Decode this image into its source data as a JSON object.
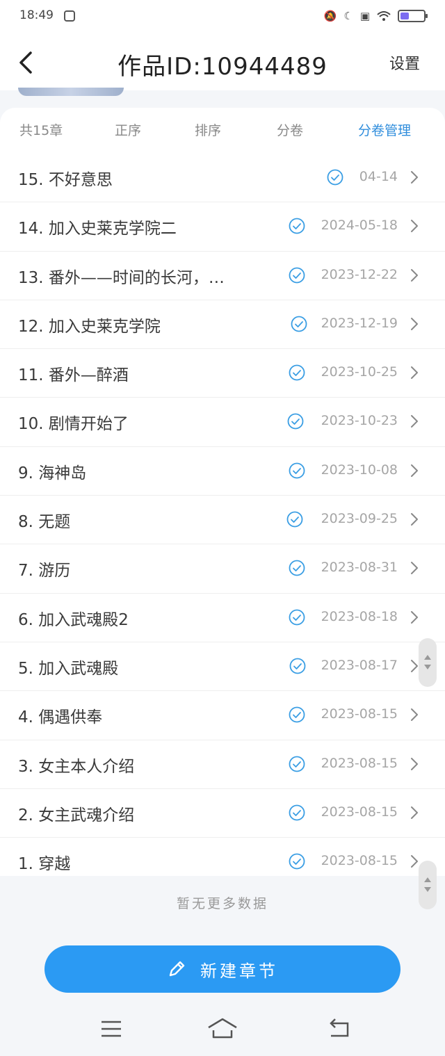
{
  "status_bar": {
    "time": "18:49"
  },
  "header": {
    "title": "作品ID:10944489",
    "settings_label": "设置"
  },
  "tabs": {
    "count": "共15章",
    "order": "正序",
    "sort": "排序",
    "volume": "分卷",
    "volume_manage": "分卷管理"
  },
  "chapters": [
    {
      "title": "15. 不好意思",
      "date": "04-14"
    },
    {
      "title": "14. 加入史莱克学院二",
      "date": "2024-05-18"
    },
    {
      "title": "13. 番外——时间的长河，…",
      "date": "2023-12-22"
    },
    {
      "title": "12. 加入史莱克学院",
      "date": "2023-12-19"
    },
    {
      "title": "11. 番外—醉酒",
      "date": "2023-10-25"
    },
    {
      "title": "10. 剧情开始了",
      "date": "2023-10-23"
    },
    {
      "title": "9. 海神岛",
      "date": "2023-10-08"
    },
    {
      "title": "8. 无题",
      "date": "2023-09-25"
    },
    {
      "title": "7. 游历",
      "date": "2023-08-31"
    },
    {
      "title": "6. 加入武魂殿2",
      "date": "2023-08-18"
    },
    {
      "title": "5. 加入武魂殿",
      "date": "2023-08-17"
    },
    {
      "title": "4. 偶遇供奉",
      "date": "2023-08-15"
    },
    {
      "title": "3. 女主本人介绍",
      "date": "2023-08-15"
    },
    {
      "title": "2. 女主武魂介绍",
      "date": "2023-08-15"
    },
    {
      "title": "1. 穿越",
      "date": "2023-08-15"
    }
  ],
  "footer": {
    "no_more": "暂无更多数据",
    "new_chapter_label": "新建章节"
  },
  "colors": {
    "accent": "#2b9af3",
    "tab_active": "#2f8ddc",
    "check": "#3a9ee4"
  }
}
